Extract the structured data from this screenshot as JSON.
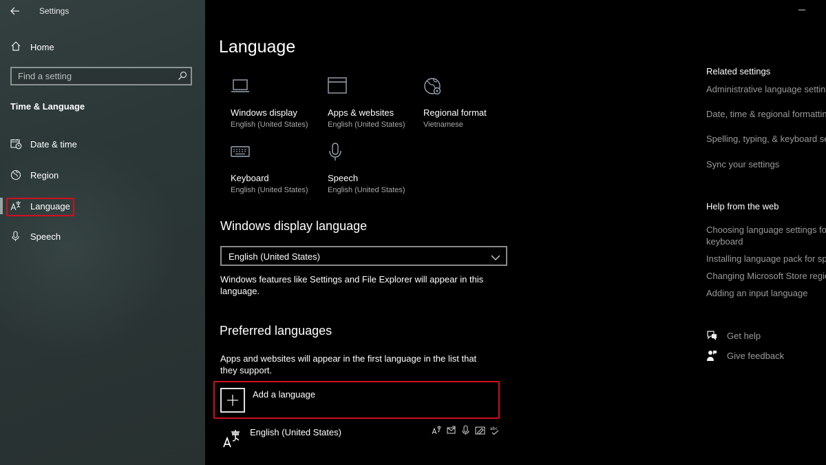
{
  "window": {
    "title": "Settings"
  },
  "sidebar": {
    "home_label": "Home",
    "search_placeholder": "Find a setting",
    "section_heading": "Time & Language",
    "items": [
      {
        "label": "Date & time",
        "icon": "calendar-clock-icon"
      },
      {
        "label": "Region",
        "icon": "globe-icon"
      },
      {
        "label": "Language",
        "icon": "language-icon",
        "selected": true
      },
      {
        "label": "Speech",
        "icon": "microphone-icon"
      }
    ]
  },
  "main": {
    "title": "Language",
    "tiles": [
      {
        "title": "Windows display",
        "subtitle": "English (United States)",
        "icon": "laptop-icon"
      },
      {
        "title": "Apps & websites",
        "subtitle": "English (United States)",
        "icon": "window-icon"
      },
      {
        "title": "Regional format",
        "subtitle": "Vietnamese",
        "icon": "globe-settings-icon"
      },
      {
        "title": "Keyboard",
        "subtitle": "English (United States)",
        "icon": "keyboard-icon"
      },
      {
        "title": "Speech",
        "subtitle": "English (United States)",
        "icon": "microphone-icon"
      }
    ],
    "display_language": {
      "heading": "Windows display language",
      "selected": "English (United States)",
      "description": "Windows features like Settings and File Explorer will appear in this language."
    },
    "preferred": {
      "heading": "Preferred languages",
      "description": "Apps and websites will appear in the first language in the list that they support.",
      "add_label": "Add a language",
      "languages": [
        {
          "name": "English (United States)",
          "features": [
            "display-language-icon",
            "text-to-speech-icon",
            "speech-recognition-icon",
            "handwriting-icon",
            "spell-check-icon"
          ]
        }
      ]
    }
  },
  "right": {
    "related_heading": "Related settings",
    "related_links": [
      "Administrative language settings",
      "Date, time & regional formatting",
      "Spelling, typing, & keyboard settings",
      "Sync your settings"
    ],
    "help_heading": "Help from the web",
    "help_links": [
      "Choosing language settings for keyboard",
      "Installing language pack for speech",
      "Changing Microsoft Store region",
      "Adding an input language"
    ],
    "get_help": "Get help",
    "give_feedback": "Give feedback"
  }
}
